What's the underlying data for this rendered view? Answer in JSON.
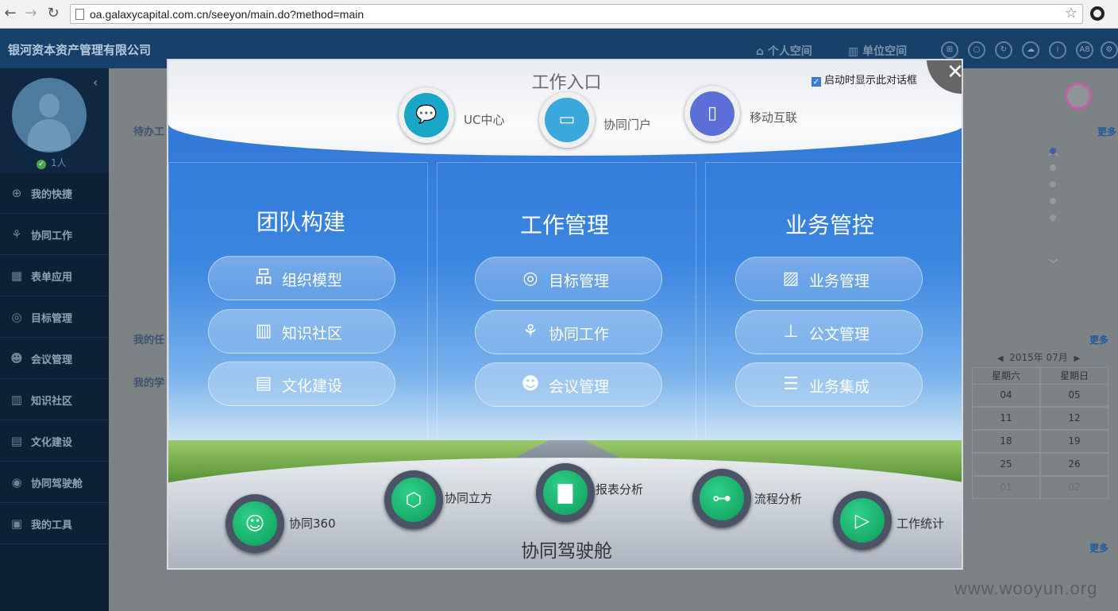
{
  "browser": {
    "url": "oa.galaxycapital.com.cn/seeyon/main.do?method=main",
    "back": "←",
    "forward": "→",
    "reload": "↻",
    "star": "☆"
  },
  "header": {
    "app_title": "银河资本资产管理有限公司",
    "personal_space": "个人空间",
    "unit_space": "单位空间",
    "icons": [
      "windows-icon",
      "search-icon",
      "refresh-icon",
      "cloud-icon",
      "info-icon",
      "font-size-icon",
      "settings-icon"
    ],
    "icon_glyphs": [
      "⊞",
      "○",
      "↻",
      "☁",
      "i",
      "A8",
      "⚙"
    ]
  },
  "sidebar": {
    "collapse": "‹",
    "online_count": "1人",
    "online_check": "✓",
    "items": [
      {
        "label": "我的快捷",
        "icon": "plus-circle-icon",
        "glyph": "⊕"
      },
      {
        "label": "协同工作",
        "icon": "share-icon",
        "glyph": "⚘"
      },
      {
        "label": "表单应用",
        "icon": "form-icon",
        "glyph": "▦"
      },
      {
        "label": "目标管理",
        "icon": "target-icon",
        "glyph": "◎"
      },
      {
        "label": "会议管理",
        "icon": "meeting-icon",
        "glyph": "☻"
      },
      {
        "label": "知识社区",
        "icon": "book-icon",
        "glyph": "▥"
      },
      {
        "label": "文化建设",
        "icon": "culture-icon",
        "glyph": "▤"
      },
      {
        "label": "协同驾驶舱",
        "icon": "dashboard-icon",
        "glyph": "◉"
      },
      {
        "label": "我的工具",
        "icon": "toolbox-icon",
        "glyph": "▣"
      }
    ]
  },
  "background": {
    "pending_label": "待办工",
    "my_tasks_label": "我的任",
    "my_study_label": "我的学",
    "more": "更多",
    "calendar": {
      "month": "2015年 07月",
      "prev": "◀",
      "next": "▶",
      "headers": [
        "星期六",
        "星期日"
      ],
      "rows": [
        [
          "04",
          "05"
        ],
        [
          "11",
          "12"
        ],
        [
          "18",
          "19"
        ],
        [
          "25",
          "26"
        ],
        [
          "01",
          "02"
        ]
      ]
    },
    "up": "︿",
    "down": "﹀",
    "watermark": "www.wooyun.org"
  },
  "dialog": {
    "title": "工作入口",
    "startup_checkbox": "启动时显示此对话框",
    "startup_checked": "✓",
    "close": "✕",
    "top_entries": [
      {
        "label": "UC中心",
        "icon": "chat-icon",
        "glyph": "💬",
        "color": "#1aa7c7"
      },
      {
        "label": "协同门户",
        "icon": "monitor-icon",
        "glyph": "▭",
        "color": "#3aa8dc"
      },
      {
        "label": "移动互联",
        "icon": "mobile-icon",
        "glyph": "▯",
        "color": "#5d6fd6"
      }
    ],
    "columns": [
      {
        "title": "团队构建",
        "items": [
          {
            "label": "组织模型",
            "icon": "org-chart-icon",
            "glyph": "品"
          },
          {
            "label": "知识社区",
            "icon": "book-icon",
            "glyph": "▥"
          },
          {
            "label": "文化建设",
            "icon": "culture-icon",
            "glyph": "▤"
          }
        ]
      },
      {
        "title": "工作管理",
        "items": [
          {
            "label": "目标管理",
            "icon": "target-icon",
            "glyph": "◎"
          },
          {
            "label": "协同工作",
            "icon": "share-icon",
            "glyph": "⚘"
          },
          {
            "label": "会议管理",
            "icon": "meeting-icon",
            "glyph": "☻"
          }
        ]
      },
      {
        "title": "业务管控",
        "items": [
          {
            "label": "业务管理",
            "icon": "clipboard-icon",
            "glyph": "▨"
          },
          {
            "label": "公文管理",
            "icon": "stamp-icon",
            "glyph": "⊥"
          },
          {
            "label": "业务集成",
            "icon": "list-icon",
            "glyph": "☰"
          }
        ]
      }
    ],
    "cockpit_title": "协同驾驶舱",
    "cockpit_items": [
      {
        "label": "协同360",
        "icon": "user-circle-icon",
        "glyph": "☺"
      },
      {
        "label": "协同立方",
        "icon": "cube-icon",
        "glyph": "⬡"
      },
      {
        "label": "报表分析",
        "icon": "bar-chart-icon",
        "glyph": "▇"
      },
      {
        "label": "流程分析",
        "icon": "flow-icon",
        "glyph": "⊶"
      },
      {
        "label": "工作统计",
        "icon": "play-circle-icon",
        "glyph": "▷"
      }
    ]
  }
}
